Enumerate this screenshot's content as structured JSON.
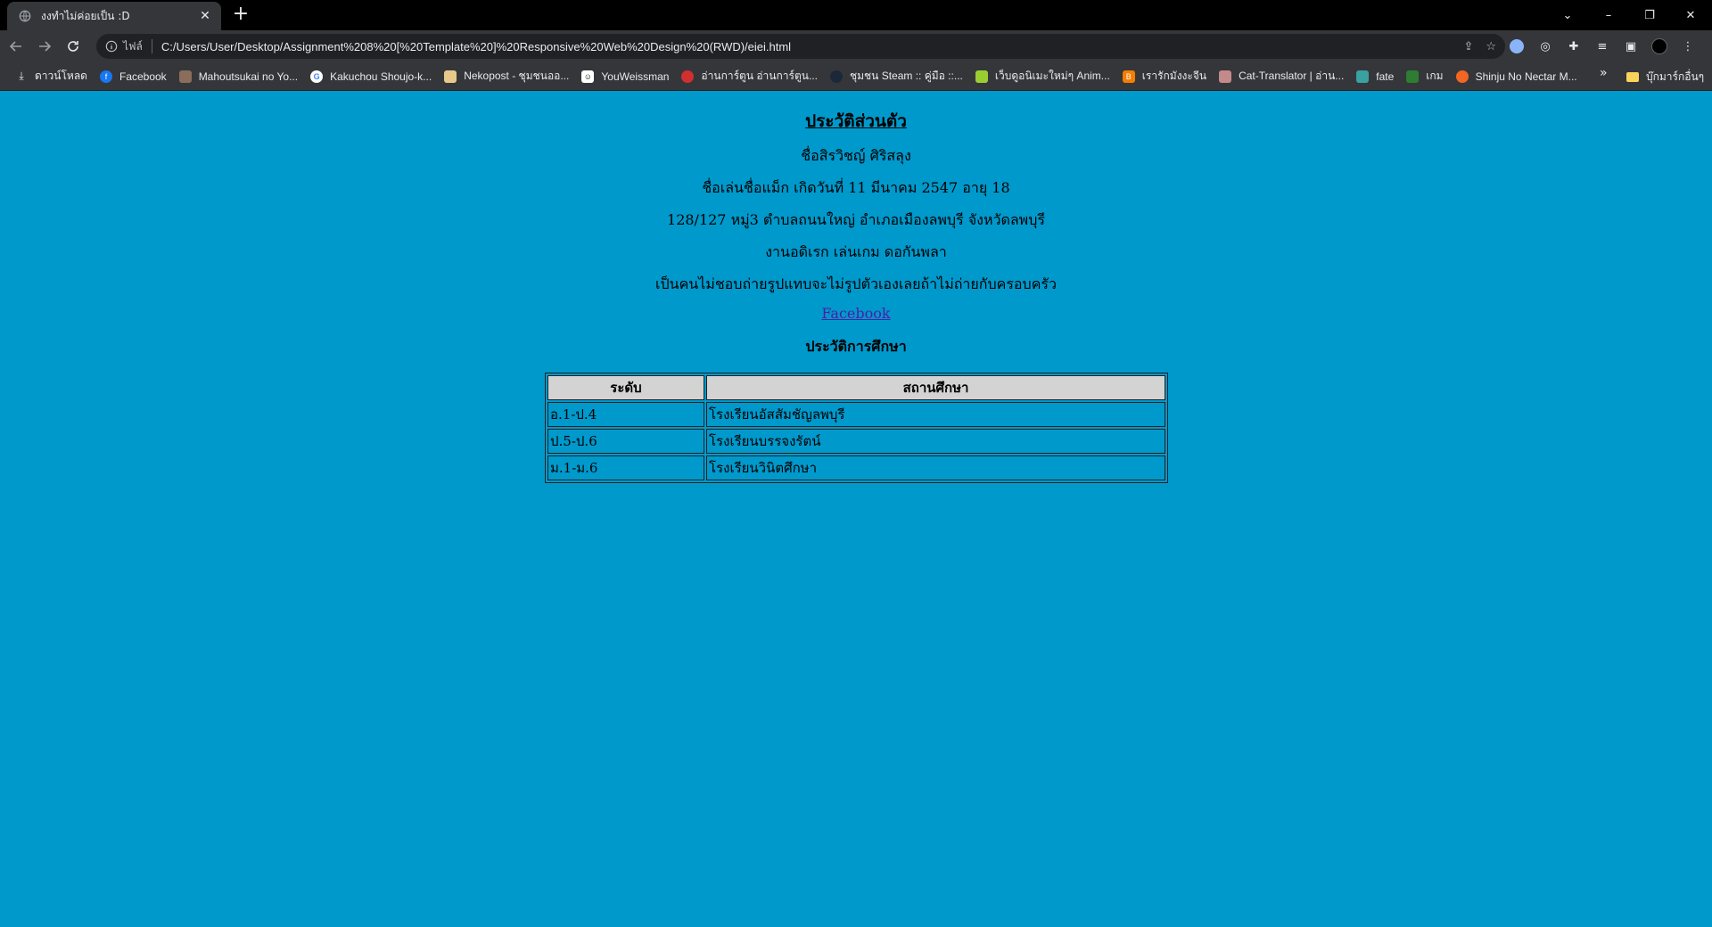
{
  "browser": {
    "tab_title": "งงทำไม่ค่อยเป็น :D",
    "url_label": "ไฟล์",
    "url": "C:/Users/User/Desktop/Assignment%208%20[%20Template%20]%20Responsive%20Web%20Design%20(RWD)/eiei.html",
    "bookmarks": [
      {
        "label": "ดาวน์โหลด",
        "icon": "download-icon",
        "color": "#e8eaed"
      },
      {
        "label": "Facebook",
        "icon": "facebook-icon",
        "color": "#1877f2"
      },
      {
        "label": "Mahoutsukai no Yo...",
        "icon": "site-icon",
        "color": "#8a6d5a"
      },
      {
        "label": "Kakuchou Shoujo-k...",
        "icon": "google-icon",
        "color": "#ffffff"
      },
      {
        "label": "Nekopost - ชุมชนออ...",
        "icon": "cat-icon",
        "color": "#e8c98a"
      },
      {
        "label": "YouWeissman",
        "icon": "person-icon",
        "color": "#ffffff"
      },
      {
        "label": "อ่านการ์ตูน อ่านการ์ตูน...",
        "icon": "site-icon",
        "color": "#d32f2f"
      },
      {
        "label": "ชุมชน Steam :: คู่มือ ::...",
        "icon": "steam-icon",
        "color": "#1b2838"
      },
      {
        "label": "เว็บดูอนิเมะใหม่ๆ Anim...",
        "icon": "site-icon",
        "color": "#9acd32"
      },
      {
        "label": "เรารักมังงะจีน",
        "icon": "blogger-icon",
        "color": "#f57d00"
      },
      {
        "label": "Cat-Translator | อ่าน...",
        "icon": "site-icon",
        "color": "#c48a8a"
      },
      {
        "label": "fate",
        "icon": "site-icon",
        "color": "#3aa0a0"
      },
      {
        "label": "เกม",
        "icon": "site-icon",
        "color": "#2e7d32"
      },
      {
        "label": "Shinju No Nectar M...",
        "icon": "site-icon",
        "color": "#f26522"
      }
    ],
    "other_bookmarks": "บุ๊กมาร์กอื่นๆ"
  },
  "profile": {
    "heading": "ประวัติส่วนตัว",
    "name": "ชื่อสิรวิชญ์ ศิริสลุง",
    "info": "ชื่อเล่นชื่อแม็ก เกิดวันที่ 11 มีนาคม 2547 อายุ 18",
    "address": "128/127 หมู่3 ตำบลถนนใหญ่ อำเภอเมืองลพบุรี จังหวัดลพบุรี",
    "hobby": "งานอดิเรก เล่นเกม ดอกันพลา",
    "about": "เป็นคนไม่ชอบถ่ายรูปแทบจะไม่รูปตัวเองเลยถ้าไม่ถ่ายกับครอบครัว",
    "link_label": "Facebook"
  },
  "education": {
    "heading": "ประวัติการศึกษา",
    "columns": [
      "ระดับ",
      "สถานศึกษา"
    ],
    "rows": [
      [
        "อ.1-ป.4",
        "โรงเรียนอัสสัมชัญลพบุรี"
      ],
      [
        "ป.5-ป.6",
        "โรงเรียนบรรจงรัตน์"
      ],
      [
        "ม.1-ม.6",
        "โรงเรียนวินิตศึกษา"
      ]
    ]
  },
  "colors": {
    "page_background": "#0099cc",
    "table_header": "#d3d3d3",
    "link": "#4a1fa8"
  }
}
